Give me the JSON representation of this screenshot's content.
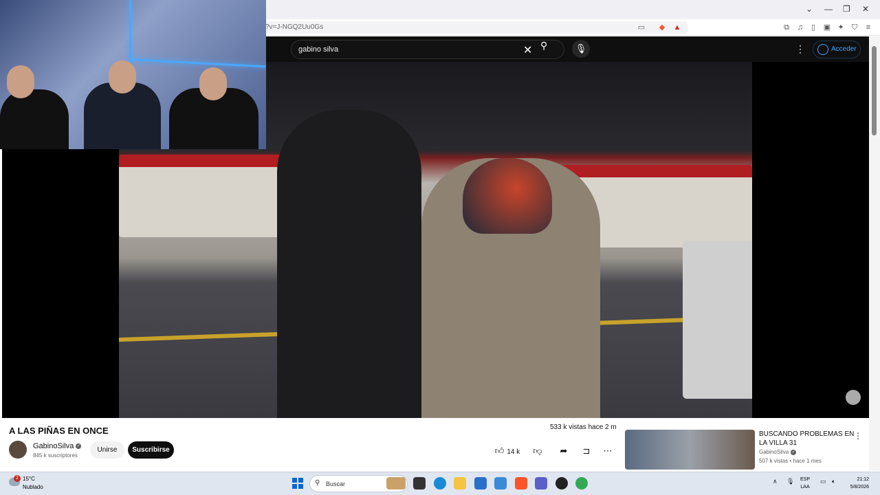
{
  "browser": {
    "url": "?v=J-NGQ2Uu0Gs"
  },
  "header": {
    "search_query": "gabino silva",
    "signin_label": "Acceder"
  },
  "video": {
    "title": "A LAS PIÑAS EN ONCE",
    "views_text": "533 k vistas  hace 2 m",
    "channel_name": "GabinoSilva",
    "subscribers": "845 k suscriptores",
    "join_label": "Unirse",
    "subscribe_label": "Suscribirse",
    "like_count": "14 k"
  },
  "recommendation": {
    "title": "BUSCANDO PROBLEMAS EN LA VILLA 31",
    "channel": "GabinoSilva",
    "meta": "507 k vistas • hace 1 mes"
  },
  "taskbar": {
    "notification_count": "2",
    "temperature": "15°C",
    "weather": "Nublado",
    "search_placeholder": "Buscar",
    "lang_top": "ESP",
    "lang_bottom": "LAA",
    "time": "21:12",
    "date": "5/8/2026"
  },
  "colors": {
    "accent_blue": "#3ea6ff",
    "yt_dark": "#0f0f0f",
    "badge_red": "#c42b1c"
  },
  "icons": [
    "minimize-icon",
    "restore-icon",
    "close-icon",
    "search-icon",
    "clear-icon",
    "mic-icon",
    "more-icon",
    "account-icon",
    "like-icon",
    "dislike-icon",
    "share-icon",
    "save-icon",
    "windows-start-icon"
  ]
}
